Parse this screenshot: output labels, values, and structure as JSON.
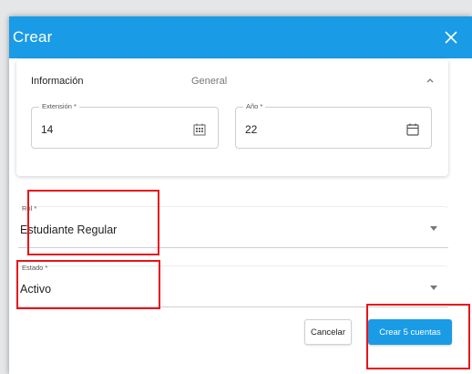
{
  "dialog": {
    "title": "Crear",
    "close_icon": "close-icon"
  },
  "info_section": {
    "title": "Información",
    "subtitle": "General",
    "collapse_icon": "chevron-up-icon",
    "fields": {
      "extension": {
        "label": "Extensión *",
        "value": "14",
        "icon": "calendar-grid-icon"
      },
      "year": {
        "label": "Año *",
        "value": "22",
        "icon": "calendar-icon"
      }
    }
  },
  "role": {
    "label": "Rol *",
    "value": "Estudiante Regular"
  },
  "status": {
    "label": "Estado *",
    "value": "Activo"
  },
  "actions": {
    "cancel_label": "Cancelar",
    "create_label": "Crear 5 cuentas"
  },
  "colors": {
    "header": "#1a9be6",
    "primary_button": "#1a9be6",
    "highlight": "#e8141b"
  }
}
